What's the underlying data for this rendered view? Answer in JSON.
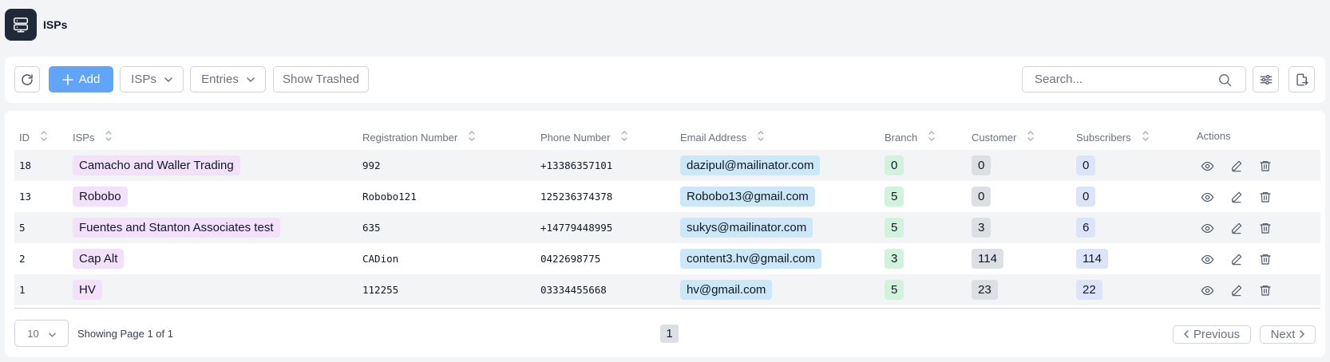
{
  "app": {
    "title": "ISPs"
  },
  "toolbar": {
    "add_label": "Add",
    "isps_dropdown": "ISPs",
    "entries_dropdown": "Entries",
    "show_trashed": "Show Trashed",
    "search_placeholder": "Search..."
  },
  "table": {
    "headers": {
      "id": "ID",
      "isps": "ISPs",
      "registration": "Registration Number",
      "phone": "Phone Number",
      "email": "Email Address",
      "branch": "Branch",
      "customer": "Customer",
      "subscribers": "Subscribers",
      "actions": "Actions"
    },
    "rows": [
      {
        "id": "18",
        "isp": "Camacho and Waller Trading",
        "registration": "992",
        "phone": "+13386357101",
        "email": "dazipul@mailinator.com",
        "branch": "0",
        "customer": "0",
        "subscribers": "0"
      },
      {
        "id": "13",
        "isp": "Robobo",
        "registration": "Robobo121",
        "phone": "125236374378",
        "email": "Robobo13@gmail.com",
        "branch": "5",
        "customer": "0",
        "subscribers": "0"
      },
      {
        "id": "5",
        "isp": "Fuentes and Stanton Associates test",
        "registration": "635",
        "phone": "+14779448995",
        "email": "sukys@mailinator.com",
        "branch": "5",
        "customer": "3",
        "subscribers": "6"
      },
      {
        "id": "2",
        "isp": "Cap Alt",
        "registration": "CADion",
        "phone": "0422698775",
        "email": "content3.hv@gmail.com",
        "branch": "3",
        "customer": "114",
        "subscribers": "114"
      },
      {
        "id": "1",
        "isp": "HV",
        "registration": "112255",
        "phone": "03334455668",
        "email": "hv@gmail.com",
        "branch": "5",
        "customer": "23",
        "subscribers": "22"
      }
    ]
  },
  "pagination": {
    "page_size": "10",
    "info": "Showing Page 1 of 1",
    "current_page": "1",
    "previous": "Previous",
    "next": "Next"
  },
  "colors": {
    "accent": "#60a5fa",
    "app_icon_bg": "#1f2937",
    "isp_pill": "#f3e0fb",
    "email_pill": "#cce7f8",
    "branch_pill": "#d1f3de",
    "customer_pill": "#dcdfe3",
    "subscribers_pill": "#dbe4f9"
  },
  "icons": [
    "server-icon",
    "refresh-icon",
    "plus-icon",
    "chevron-down-icon",
    "search-icon",
    "sliders-icon",
    "export-icon",
    "sort-icon",
    "eye-icon",
    "edit-icon",
    "trash-icon",
    "chevron-left-icon",
    "chevron-right-icon"
  ]
}
